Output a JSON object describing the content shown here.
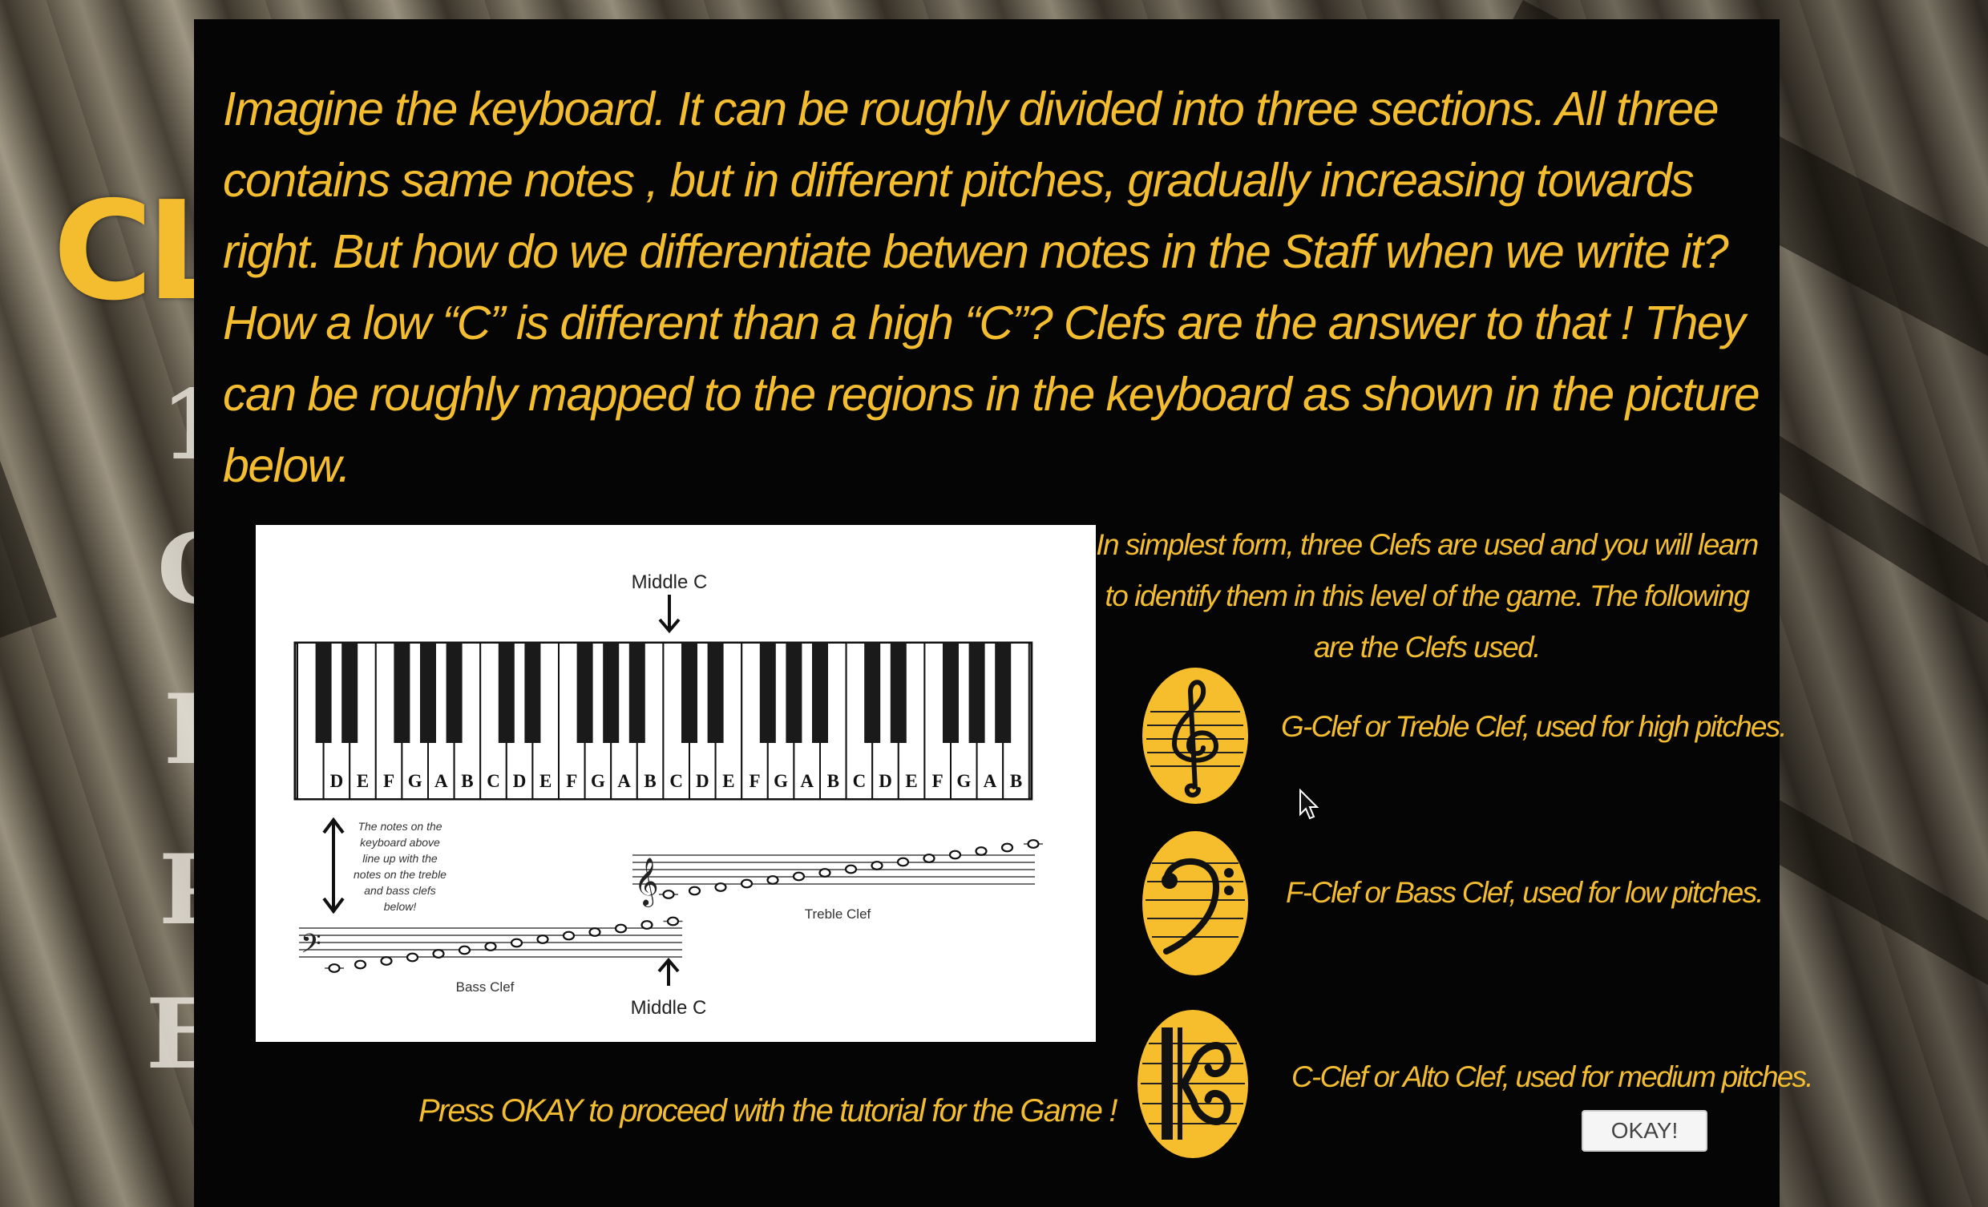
{
  "intro_text": "Imagine the keyboard. It can be roughly divided into three sections. All three contains same notes , but in different pitches, gradually increasing towards right. But how do we differentiate betwen notes in the Staff when we write it? How a low “C” is different than a high “C”? Clefs are the answer to that ! They can be roughly mapped to the regions in the keyboard as shown in the picture below.",
  "background_title_fragment": "CL",
  "diagram": {
    "middle_c_top": "Middle C",
    "middle_c_bottom": "Middle C",
    "key_letters": [
      "D",
      "E",
      "F",
      "G",
      "A",
      "B",
      "C",
      "D",
      "E",
      "F",
      "G",
      "A",
      "B",
      "C",
      "D",
      "E",
      "F",
      "G",
      "A",
      "B",
      "C",
      "D",
      "E",
      "F",
      "G",
      "A",
      "B"
    ],
    "note_caption": [
      "The notes on the",
      "keyboard above",
      "line up with the",
      "notes on the treble",
      "and bass clefs",
      "below!"
    ],
    "treble_label": "Treble Clef",
    "bass_label": "Bass Clef"
  },
  "side_text": "In simplest form, three Clefs are used and you will learn to identify them in this level of the game. The following are the Clefs used.",
  "clefs": [
    {
      "icon": "treble-clef-icon",
      "label": "G-Clef or Treble Clef, used for high pitches."
    },
    {
      "icon": "bass-clef-icon",
      "label": "F-Clef or Bass Clef, used for low pitches."
    },
    {
      "icon": "alto-clef-icon",
      "label": "C-Clef or Alto Clef, used for medium pitches."
    }
  ],
  "press_text": "Press OKAY to proceed with the tutorial for the Game !",
  "okay_button": "OKAY!",
  "colors": {
    "accent": "#f3bd2f",
    "panel": "#050505",
    "badge": "#f6bd2c"
  }
}
